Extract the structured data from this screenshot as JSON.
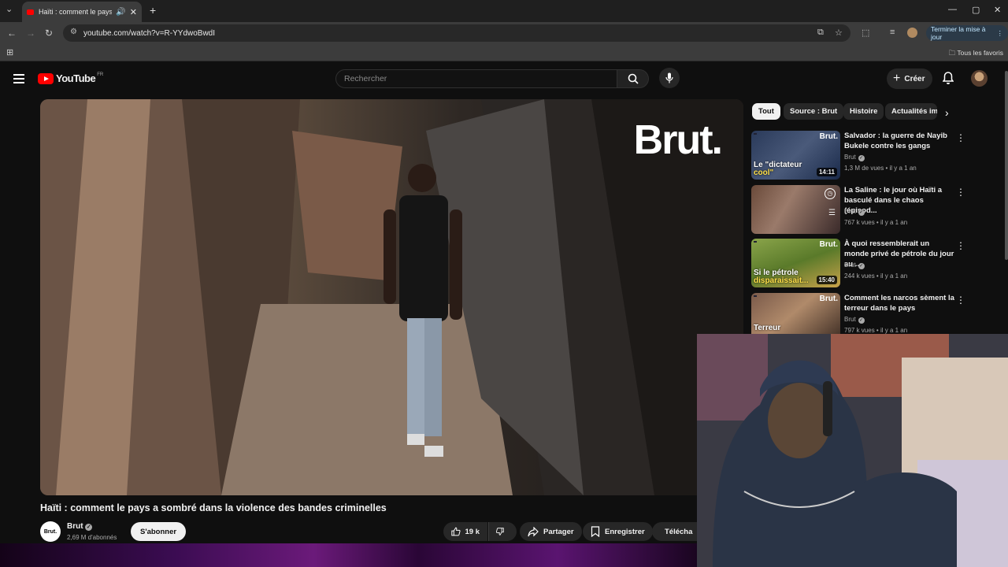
{
  "browser": {
    "tab_title": "Haïti : comment le pays a sombré dans la violence des bandes criminelles",
    "url": "youtube.com/watch?v=R-YYdwoBwdI",
    "update_button": "Terminer la mise à jour",
    "bookmarks_all": "Tous les favoris"
  },
  "header": {
    "logo_text": "YouTube",
    "country_code": "FR",
    "search_placeholder": "Rechercher",
    "create_label": "Créer"
  },
  "video": {
    "watermark": "Brut.",
    "title": "Haïti : comment le pays a sombré dans la violence des bandes criminelles",
    "channel_avatar_text": "Brut.",
    "channel": "Brut",
    "subscribers": "2,69 M d'abonnés",
    "subscribe_label": "S'abonner",
    "likes": "19 k",
    "share_label": "Partager",
    "save_label": "Enregistrer",
    "download_label": "Télécha"
  },
  "chips": [
    "Tout",
    "Source : Brut",
    "Histoire",
    "Actualités im"
  ],
  "recommendations": [
    {
      "title": "Salvador : la guerre de Nayib Bukele contre les gangs",
      "channel": "Brut",
      "meta": "1,3 M de vues • il y a 1 an",
      "duration": "14:11",
      "overlay_a": "Le \"dictateur",
      "overlay_b": "cool\"",
      "thumb_color": "#3a4a6a"
    },
    {
      "title": "La Saline : le jour où Haïti a basculé dans le chaos (épisod...",
      "channel": "Brut",
      "meta": "767 k vues • il y a 1 an",
      "duration": "",
      "thumb_color": "#7a5a4a"
    },
    {
      "title": "À quoi ressemblerait un monde privé de pétrole du jour au ...",
      "channel": "Brut",
      "meta": "244 k vues • il y a 1 an",
      "duration": "15:40",
      "overlay_a": "Si le pétrole",
      "overlay_b": "disparaissait...",
      "thumb_color": "#6a8a3a"
    },
    {
      "title": "Comment les narcos sèment la terreur dans le pays",
      "channel": "Brut",
      "meta": "797 k vues • il y a 1 an",
      "duration": "",
      "overlay_a": "Terreur",
      "thumb_color": "#6a4a3a"
    }
  ],
  "colors": {
    "accent_red": "#ff0000",
    "bg": "#0f0f0f",
    "chip_bg": "#272727"
  },
  "icons": [
    "menu-icon",
    "search-icon",
    "mic-icon",
    "bell-icon",
    "like-icon",
    "dislike-icon",
    "share-icon",
    "save-icon",
    "download-icon"
  ]
}
